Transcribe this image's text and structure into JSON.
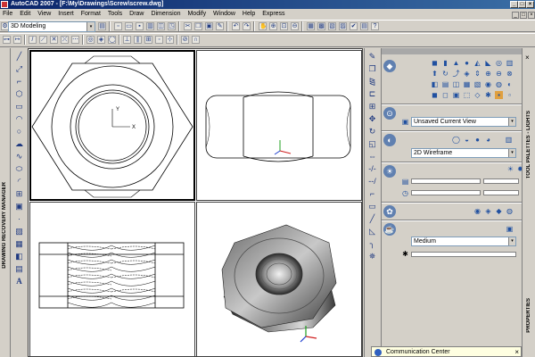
{
  "window": {
    "title": "AutoCAD 2007 - [F:\\My\\Drawings\\Screw\\screw.dwg]",
    "min_glyph": "_",
    "max_glyph": "□",
    "close_glyph": "×"
  },
  "menubar": {
    "items": [
      "File",
      "Edit",
      "View",
      "Insert",
      "Format",
      "Tools",
      "Draw",
      "Dimension",
      "Modify",
      "Window",
      "Help",
      "Express"
    ],
    "doc_min": "_",
    "doc_max": "□",
    "doc_close": "×"
  },
  "toolbar": {
    "workspace": "3D Modeling",
    "dropdown_glyph": "▾"
  },
  "left_palette": {
    "label": "DRAWING RECOVERY MANAGER"
  },
  "right_palette": {
    "label_top": "TOOL PALETTES - LIGHTS",
    "label_bottom": "PROPERTIES"
  },
  "dashboard": {
    "view_select": "Unsaved Current View",
    "visual_style": "2D Wireframe",
    "render_quality": "Medium"
  },
  "comm_center": {
    "label": "Communication Center",
    "close_glyph": "×"
  },
  "accent": {
    "titlebar": "#0a246a",
    "ucs_x": "#d02020",
    "ucs_y": "#20a020",
    "ucs_z": "#2040d0"
  },
  "icons": {
    "draw_tools": [
      "line-icon",
      "construction-line-icon",
      "polyline-icon",
      "polygon-icon",
      "rectangle-icon",
      "arc-icon",
      "circle-icon",
      "revision-cloud-icon",
      "spline-icon",
      "ellipse-icon",
      "ellipse-arc-icon",
      "insert-block-icon",
      "make-block-icon",
      "point-icon",
      "hatch-icon",
      "gradient-icon",
      "region-icon",
      "table-icon",
      "multiline-text-icon"
    ],
    "modify_tools": [
      "erase-icon",
      "copy-icon",
      "mirror-icon",
      "offset-icon",
      "array-icon",
      "move-icon",
      "rotate-icon",
      "scale-icon",
      "stretch-icon",
      "trim-icon",
      "extend-icon",
      "break-at-point-icon",
      "break-icon",
      "join-icon",
      "chamfer-icon",
      "fillet-icon",
      "explode-icon"
    ]
  }
}
